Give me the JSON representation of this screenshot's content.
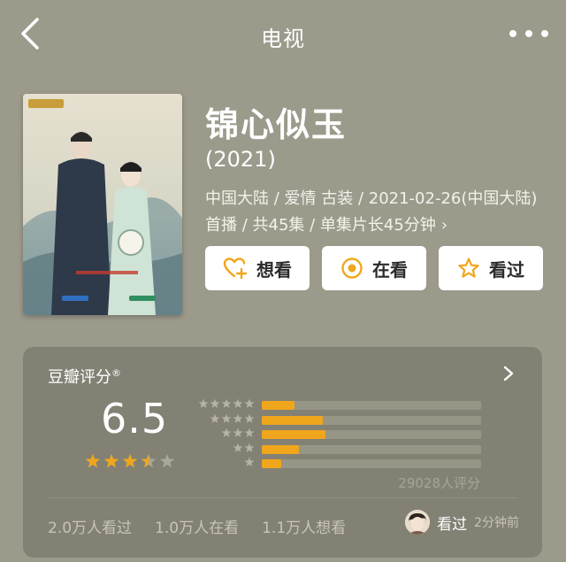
{
  "header": {
    "title": "电视"
  },
  "movie": {
    "title": "锦心似玉",
    "year": "(2021)",
    "meta": "中国大陆 / 爱情 古装 / 2021-02-26(中国大陆)首播 / 共45集 / 单集片长45分钟",
    "meta_chevron": "›"
  },
  "actions": {
    "want_label": "想看",
    "watching_label": "在看",
    "watched_label": "看过"
  },
  "rating": {
    "header_label": "豆瓣评分",
    "header_mark": "®",
    "score": "6.5",
    "stars_value": 3.5,
    "stars_max": 5,
    "distribution": [
      {
        "stars": 5,
        "fraction": 0.15
      },
      {
        "stars": 4,
        "fraction": 0.28
      },
      {
        "stars": 3,
        "fraction": 0.29
      },
      {
        "stars": 2,
        "fraction": 0.17
      },
      {
        "stars": 1,
        "fraction": 0.09
      }
    ],
    "count_text": "29028人评分",
    "watched_text": "2.0万人看过",
    "watching_text": "1.0万人在看",
    "want_text": "1.1万人想看",
    "status_label": "看过",
    "status_time": "2分钟前"
  },
  "colors": {
    "background": "#9c9a8b",
    "card": "#838174",
    "accent": "#f0a61c",
    "bar_track": "#979586"
  }
}
